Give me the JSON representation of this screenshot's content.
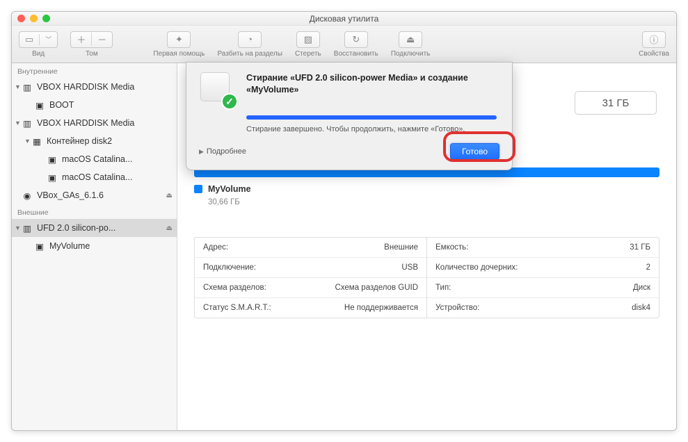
{
  "window": {
    "title": "Дисковая утилита"
  },
  "toolbar": {
    "view": "Вид",
    "volume": "Том",
    "first_aid": "Первая помощь",
    "partition": "Разбить на разделы",
    "erase": "Стереть",
    "restore": "Восстановить",
    "mount": "Подключить",
    "info": "Свойства"
  },
  "sidebar": {
    "internal_header": "Внутренние",
    "external_header": "Внешние",
    "items": {
      "hd1": "VBOX HARDDISK Media",
      "boot": "BOOT",
      "hd2": "VBOX HARDDISK Media",
      "container": "Контейнер disk2",
      "cat1": "macOS Catalina...",
      "cat2": "macOS Catalina...",
      "vboxga": "VBox_GAs_6.1.6",
      "ufd": "UFD 2.0 silicon-po...",
      "myvol": "MyVolume"
    }
  },
  "dialog": {
    "title_line1": "Стирание «UFD 2.0 silicon-power Media» и создание",
    "title_line2": "«MyVolume»",
    "message": "Стирание завершено. Чтобы продолжить, нажмите «Готово».",
    "details": "Подробнее",
    "done": "Готово"
  },
  "volume": {
    "name": "MyVolume",
    "size": "30,66 ГБ",
    "capacity_badge": "31 ГБ"
  },
  "info": {
    "left": [
      {
        "k": "Адрес:",
        "v": "Внешние"
      },
      {
        "k": "Подключение:",
        "v": "USB"
      },
      {
        "k": "Схема разделов:",
        "v": "Схема разделов GUID"
      },
      {
        "k": "Статус S.M.A.R.T.:",
        "v": "Не поддерживается"
      }
    ],
    "right": [
      {
        "k": "Емкость:",
        "v": "31 ГБ"
      },
      {
        "k": "Количество дочерних:",
        "v": "2"
      },
      {
        "k": "Тип:",
        "v": "Диск"
      },
      {
        "k": "Устройство:",
        "v": "disk4"
      }
    ]
  }
}
